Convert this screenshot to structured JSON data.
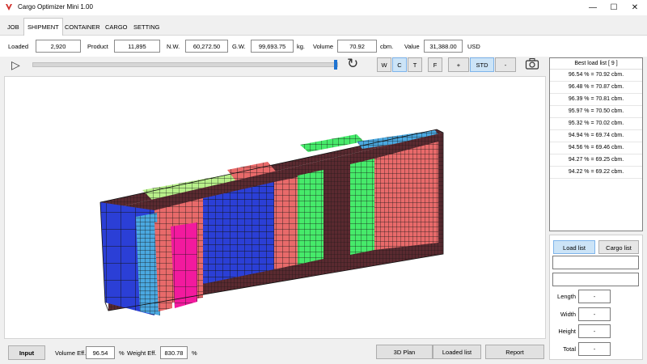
{
  "window": {
    "title": "Cargo Optimizer Mini 1.00",
    "minimize": "—",
    "maximize": "☐",
    "close": "✕"
  },
  "tabs": [
    "JOB",
    "SHIPMENT",
    "CONTAINER",
    "CARGO",
    "SETTING"
  ],
  "active_tab": "SHIPMENT",
  "info": {
    "loaded_label": "Loaded",
    "loaded_value": "2,920",
    "product_label": "Product",
    "product_value": "11,895",
    "nw_label": "N.W.",
    "nw_value": "60,272.50",
    "gw_label": "G.W.",
    "gw_value": "99,693.75",
    "gw_unit": "kg.",
    "volume_label": "Volume",
    "volume_value": "70.92",
    "volume_unit": "cbm.",
    "value_label": "Value",
    "value_value": "31,388.00",
    "value_unit": "USD"
  },
  "toolbar": {
    "play_icon": "▷",
    "progress": 1.0,
    "reset_icon": "↻",
    "view_buttons": [
      "W",
      "C",
      "T"
    ],
    "selected_view": "C",
    "f_label": "F",
    "zoom_plus": "+",
    "zoom_std": "STD",
    "zoom_minus": "-",
    "camera_icon": "camera-icon"
  },
  "best_load_list": {
    "header": "Best load list [ 9 ]",
    "items": [
      "96.54 % = 70.92 cbm.",
      "96.48 % = 70.87 cbm.",
      "96.39 % = 70.81 cbm.",
      "95.97 % = 70.50 cbm.",
      "95.32 % = 70.02 cbm.",
      "94.94 % = 69.74 cbm.",
      "94.56 % = 69.46 cbm.",
      "94.27 % = 69.25 cbm.",
      "94.22 % = 69.22 cbm."
    ]
  },
  "side_panel": {
    "load_list_label": "Load list",
    "cargo_list_label": "Cargo list",
    "field1": "",
    "field2": "",
    "length_label": "Length",
    "length_value": "-",
    "width_label": "Width",
    "width_value": "-",
    "height_label": "Height",
    "height_value": "-",
    "total_label": "Total",
    "total_value": "-"
  },
  "bottom": {
    "input_label": "Input",
    "volume_eff_label": "Volume Eff.",
    "volume_eff_value": "96.54",
    "volume_eff_unit": "%",
    "weight_eff_label": "Weight Eff.",
    "weight_eff_value": "830.78",
    "weight_eff_unit": "%",
    "plan_3d_label": "3D Plan",
    "loaded_list_label": "Loaded list",
    "report_label": "Report"
  },
  "colors": {
    "blue": "#2b3fd6",
    "pink": "#e86a6a",
    "magenta": "#f21a9e",
    "lightblue": "#4aa8e0",
    "green": "#46ea6a",
    "lightgreen": "#b8f08a",
    "brown": "#5a2a30",
    "grid": "#1a1a1a"
  }
}
